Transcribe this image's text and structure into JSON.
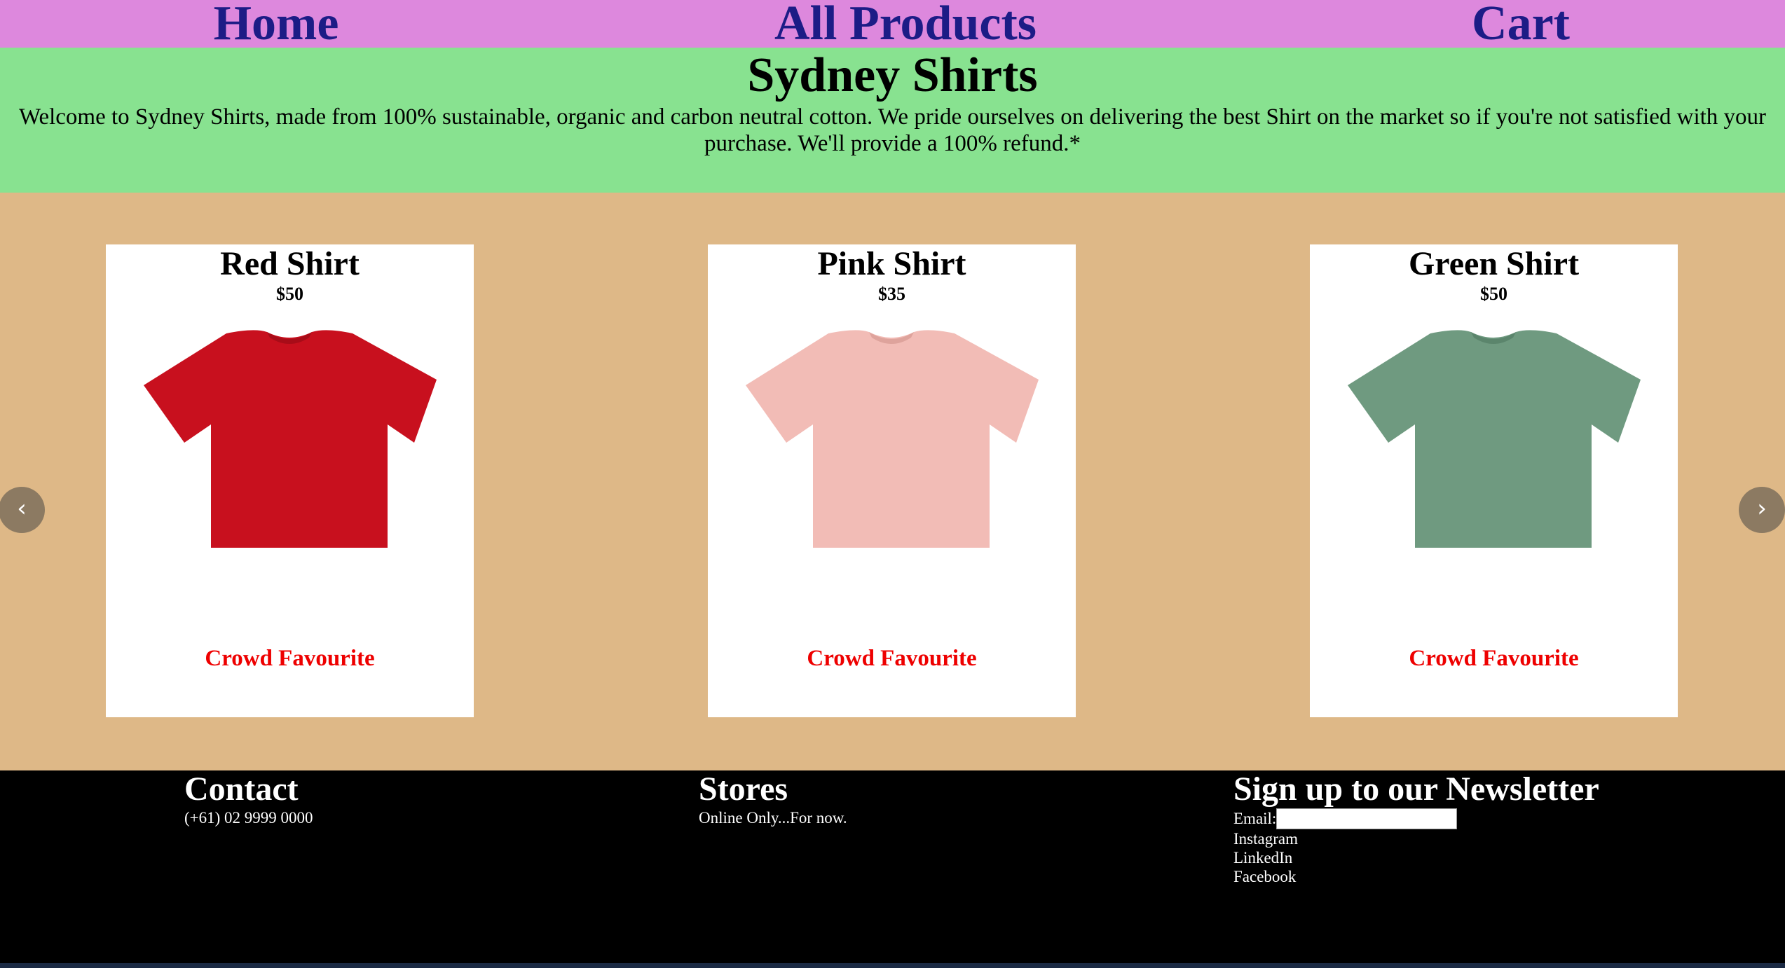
{
  "nav": {
    "home": "Home",
    "all_products": "All Products",
    "cart": "Cart"
  },
  "hero": {
    "title": "Sydney Shirts",
    "text": "Welcome to Sydney Shirts, made from 100% sustainable, organic and carbon neutral cotton. We pride ourselves on delivering the best Shirt on the market so if you're not satisfied with your purchase. We'll provide a 100% refund.*"
  },
  "carousel": {
    "prev": "‹",
    "next": "›",
    "products": [
      {
        "name": "Red Shirt",
        "price": "$50",
        "badge": "Crowd Favourite",
        "shirt_color": "#c8101e",
        "shade_color": "#a80c18"
      },
      {
        "name": "Pink Shirt",
        "price": "$35",
        "badge": "Crowd Favourite",
        "shirt_color": "#f2bcb6",
        "shade_color": "#dea39c"
      },
      {
        "name": "Green Shirt",
        "price": "$50",
        "badge": "Crowd Favourite",
        "shirt_color": "#6f9a80",
        "shade_color": "#5b856c"
      }
    ]
  },
  "footer": {
    "contact": {
      "heading": "Contact",
      "phone": "(+61) 02 9999 0000"
    },
    "stores": {
      "heading": "Stores",
      "text": "Online Only...For now."
    },
    "newsletter": {
      "heading": "Sign up to our Newsletter",
      "email_label": "Email:",
      "email_value": "",
      "links": [
        "Instagram",
        "LinkedIn",
        "Facebook"
      ]
    }
  },
  "colors": {
    "nav_bg": "#dd88dd",
    "nav_text": "#1c1c86",
    "hero_bg": "#88e290",
    "carousel_bg": "#deb887",
    "badge_text": "#ee0000",
    "footer_bg": "#000000"
  }
}
